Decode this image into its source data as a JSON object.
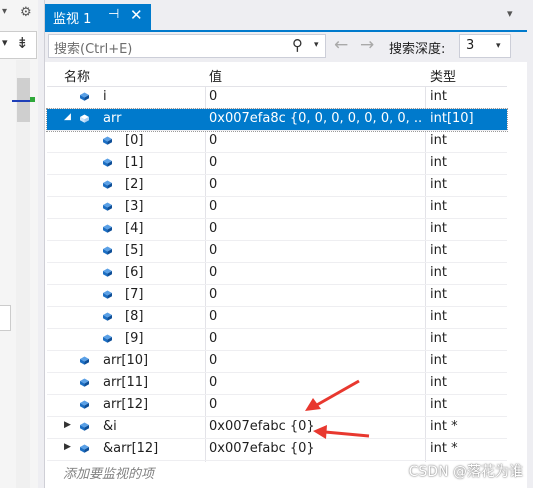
{
  "left_panel": {
    "icon_1": "▾",
    "icon_2": "⚙",
    "icon_3": "▾",
    "icon_4": "⇟"
  },
  "tab": {
    "title": "监视 1",
    "pin_icon": "⊣",
    "close_icon": "✕",
    "overflow_icon": "▾"
  },
  "toolbar": {
    "search_placeholder": "搜索(Ctrl+E)",
    "search_icon": "⚲",
    "search_caret": "▾",
    "back_icon": "←",
    "forward_icon": "→",
    "depth_label": "搜索深度:",
    "depth_value": "3",
    "depth_caret": "▾"
  },
  "columns": {
    "name": "名称",
    "value": "值",
    "type": "类型"
  },
  "rows": [
    {
      "name": "i",
      "value": "0",
      "type": "int",
      "level": 0,
      "expander": ""
    },
    {
      "name": "arr",
      "value": "0x007efa8c {0, 0, 0, 0, 0, 0, 0, ...",
      "type": "int[10]",
      "level": 0,
      "expander": "◢",
      "selected": true
    },
    {
      "name": "[0]",
      "value": "0",
      "type": "int",
      "level": 1,
      "expander": ""
    },
    {
      "name": "[1]",
      "value": "0",
      "type": "int",
      "level": 1,
      "expander": ""
    },
    {
      "name": "[2]",
      "value": "0",
      "type": "int",
      "level": 1,
      "expander": ""
    },
    {
      "name": "[3]",
      "value": "0",
      "type": "int",
      "level": 1,
      "expander": ""
    },
    {
      "name": "[4]",
      "value": "0",
      "type": "int",
      "level": 1,
      "expander": ""
    },
    {
      "name": "[5]",
      "value": "0",
      "type": "int",
      "level": 1,
      "expander": ""
    },
    {
      "name": "[6]",
      "value": "0",
      "type": "int",
      "level": 1,
      "expander": ""
    },
    {
      "name": "[7]",
      "value": "0",
      "type": "int",
      "level": 1,
      "expander": ""
    },
    {
      "name": "[8]",
      "value": "0",
      "type": "int",
      "level": 1,
      "expander": ""
    },
    {
      "name": "[9]",
      "value": "0",
      "type": "int",
      "level": 1,
      "expander": ""
    },
    {
      "name": "arr[10]",
      "value": "0",
      "type": "int",
      "level": 0,
      "expander": ""
    },
    {
      "name": "arr[11]",
      "value": "0",
      "type": "int",
      "level": 0,
      "expander": ""
    },
    {
      "name": "arr[12]",
      "value": "0",
      "type": "int",
      "level": 0,
      "expander": ""
    },
    {
      "name": "&i",
      "value": "0x007efabc {0}",
      "type": "int *",
      "level": 0,
      "expander": "▶"
    },
    {
      "name": "&arr[12]",
      "value": "0x007efabc {0}",
      "type": "int *",
      "level": 0,
      "expander": "▶"
    }
  ],
  "add_watch_placeholder": "添加要监视的项",
  "watermark": "CSDN @落花为谁",
  "colors": {
    "accent": "#007acc",
    "cube_blue": "#1c6fc4",
    "arrow_red": "#e8382f"
  }
}
